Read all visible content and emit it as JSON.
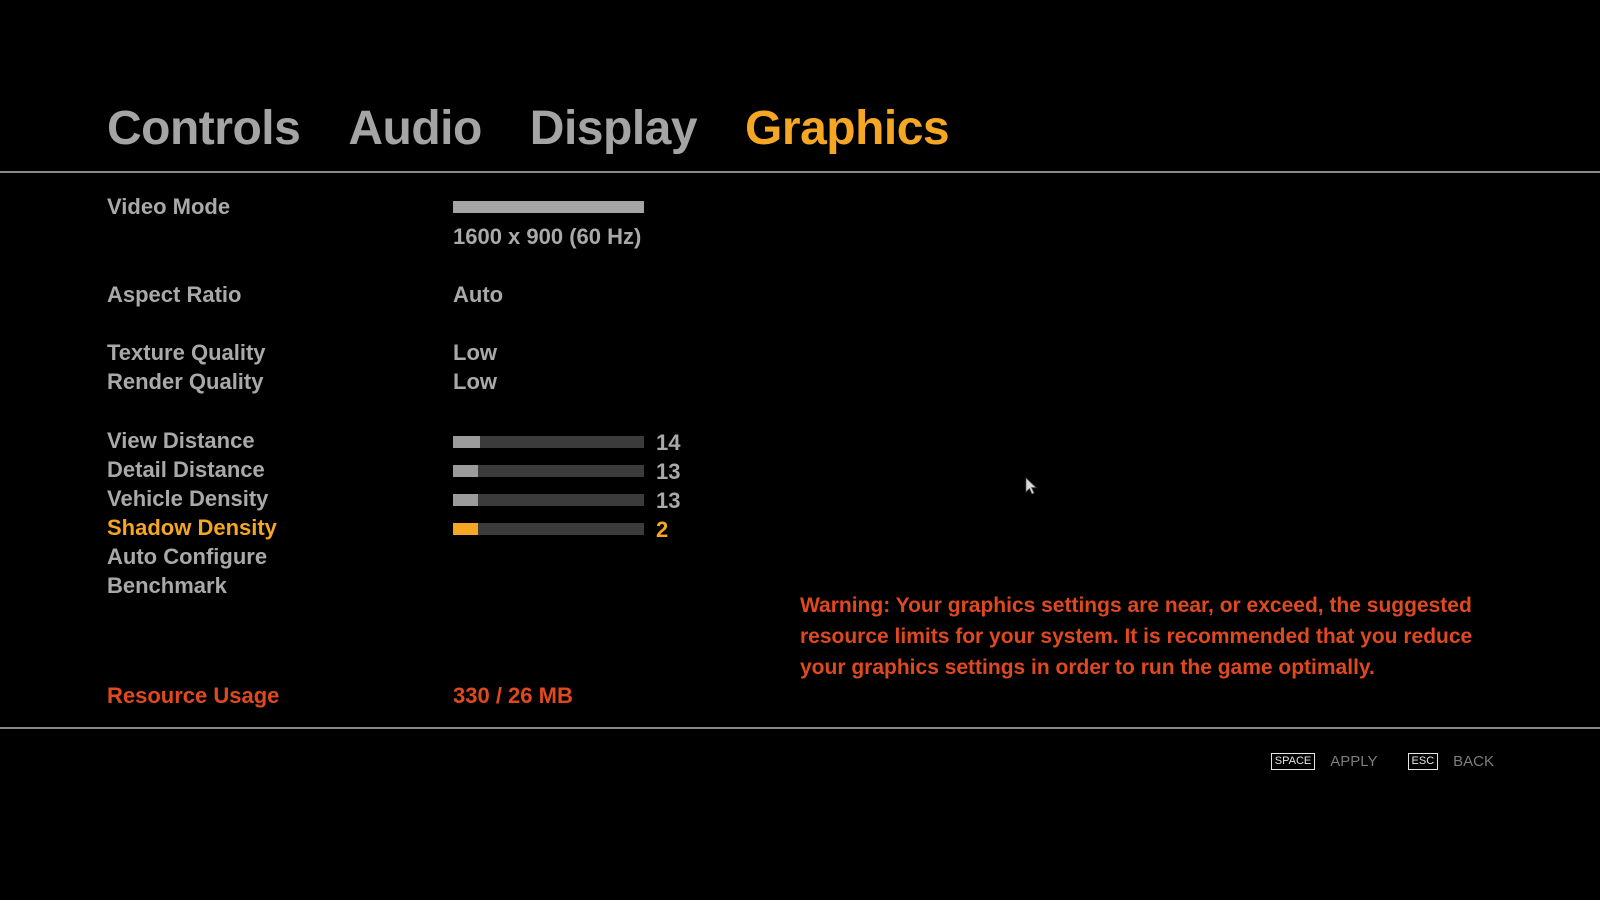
{
  "tabs": [
    {
      "label": "Controls",
      "active": false
    },
    {
      "label": "Audio",
      "active": false
    },
    {
      "label": "Display",
      "active": false
    },
    {
      "label": "Graphics",
      "active": true
    }
  ],
  "settings": {
    "video_mode": {
      "label": "Video Mode",
      "value": "1600 x 900 (60 Hz)"
    },
    "aspect_ratio": {
      "label": "Aspect Ratio",
      "value": "Auto"
    },
    "texture_quality": {
      "label": "Texture Quality",
      "value": "Low"
    },
    "render_quality": {
      "label": "Render Quality",
      "value": "Low"
    },
    "view_distance": {
      "label": "View Distance",
      "value": "14",
      "fraction": 0.14
    },
    "detail_distance": {
      "label": "Detail Distance",
      "value": "13",
      "fraction": 0.13
    },
    "vehicle_density": {
      "label": "Vehicle Density",
      "value": "13",
      "fraction": 0.13
    },
    "shadow_density": {
      "label": "Shadow Density",
      "value": "2",
      "fraction": 0.13,
      "selected": true
    },
    "auto_configure": {
      "label": "Auto Configure"
    },
    "benchmark": {
      "label": "Benchmark"
    }
  },
  "resource": {
    "label": "Resource Usage",
    "value": "330 / 26 MB"
  },
  "warning": "Warning: Your graphics settings are near, or exceed, the suggested resource limits for your system. It is recommended that you reduce your graphics settings in order to run the game optimally.",
  "footer": {
    "apply_key": "SPACE",
    "apply_label": "APPLY",
    "back_key": "ESC",
    "back_label": "BACK"
  },
  "colors": {
    "accent": "#f5a623",
    "text": "#a9a9a9",
    "warning": "#e0491f",
    "slider_track": "#3b3b3b",
    "background": "#000000"
  },
  "icons": {
    "cursor": "mouse-cursor-icon"
  }
}
